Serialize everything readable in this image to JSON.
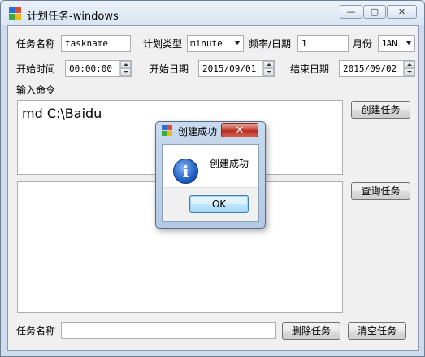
{
  "window": {
    "title": "计划任务-windows",
    "caption_buttons": {
      "minimize": "—",
      "maximize": "▢",
      "close": "✕"
    }
  },
  "form": {
    "task_name_label": "任务名称",
    "task_name_value": "taskname",
    "schedule_type_label": "计划类型",
    "schedule_type_value": "minute",
    "frequency_label": "频率/日期",
    "frequency_value": "1",
    "month_label": "月份",
    "month_value": "JAN",
    "start_time_label": "开始时间",
    "start_time_value": "00:00:00",
    "start_date_label": "开始日期",
    "start_date_value": "2015/09/01",
    "end_date_label": "结束日期",
    "end_date_value": "2015/09/02",
    "command_label": "输入命令",
    "command_value": "md C:\\Baidu"
  },
  "buttons": {
    "create_task": "创建任务",
    "query_task": "查询任务",
    "delete_task": "删除任务",
    "clear_task": "清空任务"
  },
  "bottom": {
    "task_name_label": "任务名称",
    "task_name_value": ""
  },
  "dialog": {
    "title": "创建成功",
    "message": "创建成功",
    "ok_label": "OK",
    "close_glyph": "✕",
    "icon": "info-icon"
  },
  "colors": {
    "frame": "#dfe9f5",
    "client": "#f0f0f0",
    "close_red": "#c7453a",
    "info_blue": "#1f5fc4"
  }
}
